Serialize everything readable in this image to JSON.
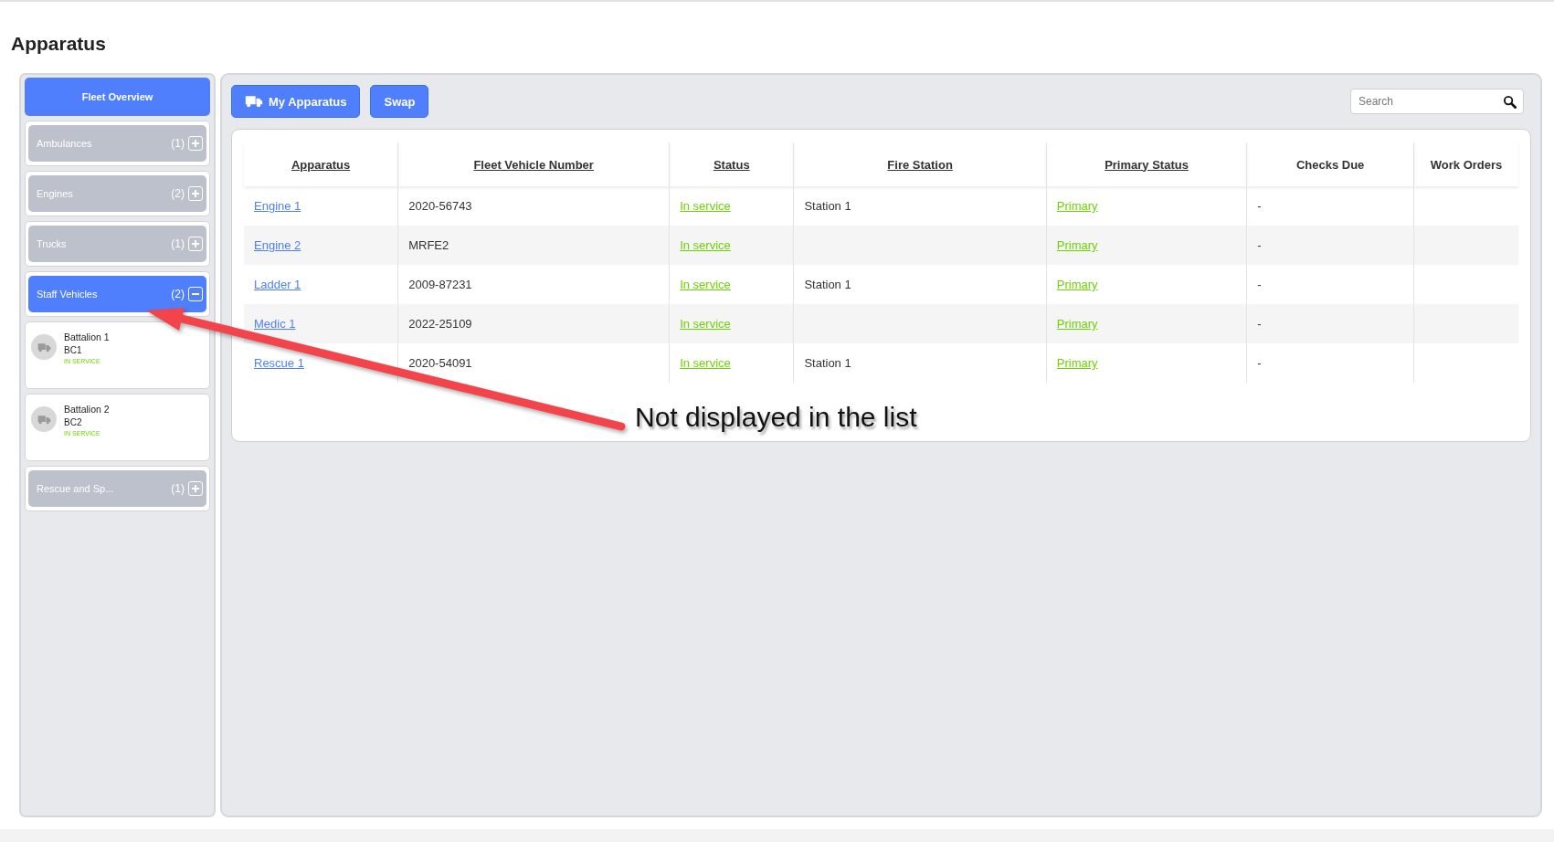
{
  "page_title": "Apparatus",
  "sidebar": {
    "overview_button": "Fleet Overview",
    "categories": [
      {
        "label": "Ambulances",
        "count": "(1)",
        "expanded": false
      },
      {
        "label": "Engines",
        "count": "(2)",
        "expanded": false
      },
      {
        "label": "Trucks",
        "count": "(1)",
        "expanded": false
      },
      {
        "label": "Staff Vehicles",
        "count": "(2)",
        "expanded": true,
        "vehicles": [
          {
            "name": "Battalion 1",
            "code": "BC1",
            "status": "IN SERVICE"
          },
          {
            "name": "Battalion 2",
            "code": "BC2",
            "status": "IN SERVICE"
          }
        ]
      },
      {
        "label": "Rescue and Sp...",
        "count": "(1)",
        "expanded": false
      }
    ]
  },
  "toolbar": {
    "buttons": [
      {
        "label": "My Apparatus"
      },
      {
        "label": "Swap"
      }
    ],
    "search": {
      "placeholder": "Search"
    }
  },
  "table": {
    "columns": [
      {
        "label": "Apparatus",
        "sortable": true
      },
      {
        "label": "Fleet Vehicle Number",
        "sortable": true
      },
      {
        "label": "Status",
        "sortable": true
      },
      {
        "label": "Fire Station",
        "sortable": true
      },
      {
        "label": "Primary Status",
        "sortable": true
      },
      {
        "label": "Checks Due",
        "sortable": false
      },
      {
        "label": "Work Orders",
        "sortable": false
      }
    ],
    "rows": [
      {
        "apparatus": "Engine 1",
        "fleet_number": "2020-56743",
        "status": "In service",
        "fire_station": "Station 1",
        "primary_status": "Primary",
        "checks_due": "-"
      },
      {
        "apparatus": "Engine 2",
        "fleet_number": "MRFE2",
        "status": "In service",
        "primary_status": "Primary",
        "checks_due": "-"
      },
      {
        "apparatus": "Ladder 1",
        "fleet_number": "2009-87231",
        "status": "In service",
        "fire_station": "Station 1",
        "primary_status": "Primary",
        "checks_due": "-"
      },
      {
        "apparatus": "Medic 1",
        "fleet_number": "2022-25109",
        "status": "In service",
        "primary_status": "Primary",
        "checks_due": "-"
      },
      {
        "apparatus": "Rescue 1",
        "fleet_number": "2020-54091",
        "status": "In service",
        "fire_station": "Station 1",
        "primary_status": "Primary",
        "checks_due": "-"
      }
    ]
  },
  "annotation": {
    "text": "Not displayed in the list"
  }
}
